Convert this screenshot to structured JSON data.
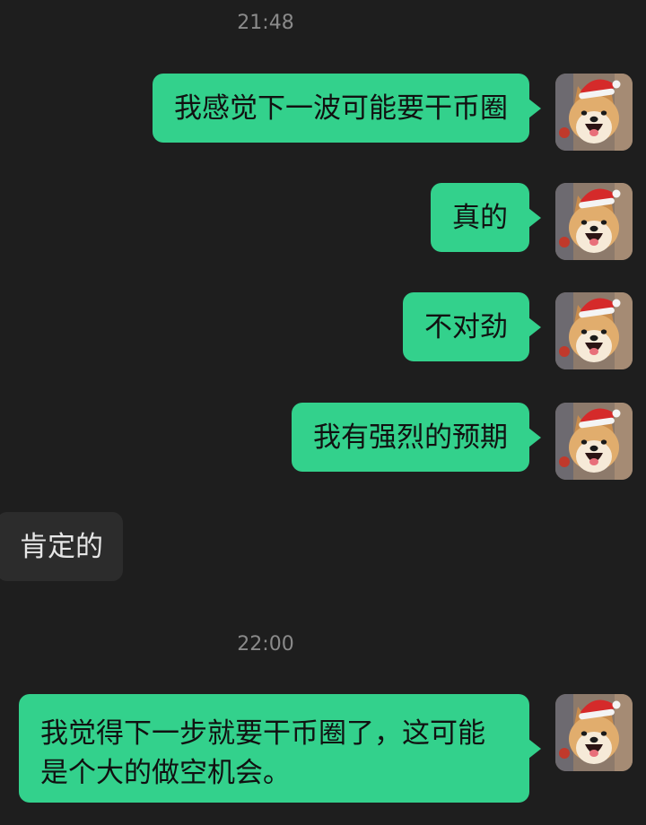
{
  "timestamps": [
    "21:48",
    "22:00"
  ],
  "messages": [
    {
      "side": "out",
      "text": "我感觉下一波可能要干币圈"
    },
    {
      "side": "out",
      "text": "真的"
    },
    {
      "side": "out",
      "text": "不对劲"
    },
    {
      "side": "out",
      "text": "我有强烈的预期"
    },
    {
      "side": "in",
      "text": "肯定的"
    },
    {
      "side": "out",
      "text": "我觉得下一步就要干币圈了，这可能是个大的做空机会。"
    }
  ],
  "colors": {
    "background": "#1e1e1e",
    "outgoing_bubble": "#33d18c",
    "incoming_bubble": "#2c2c2c",
    "timestamp": "#8a8a8a"
  },
  "avatar_icon": "shiba-inu-santa-hat-avatar"
}
